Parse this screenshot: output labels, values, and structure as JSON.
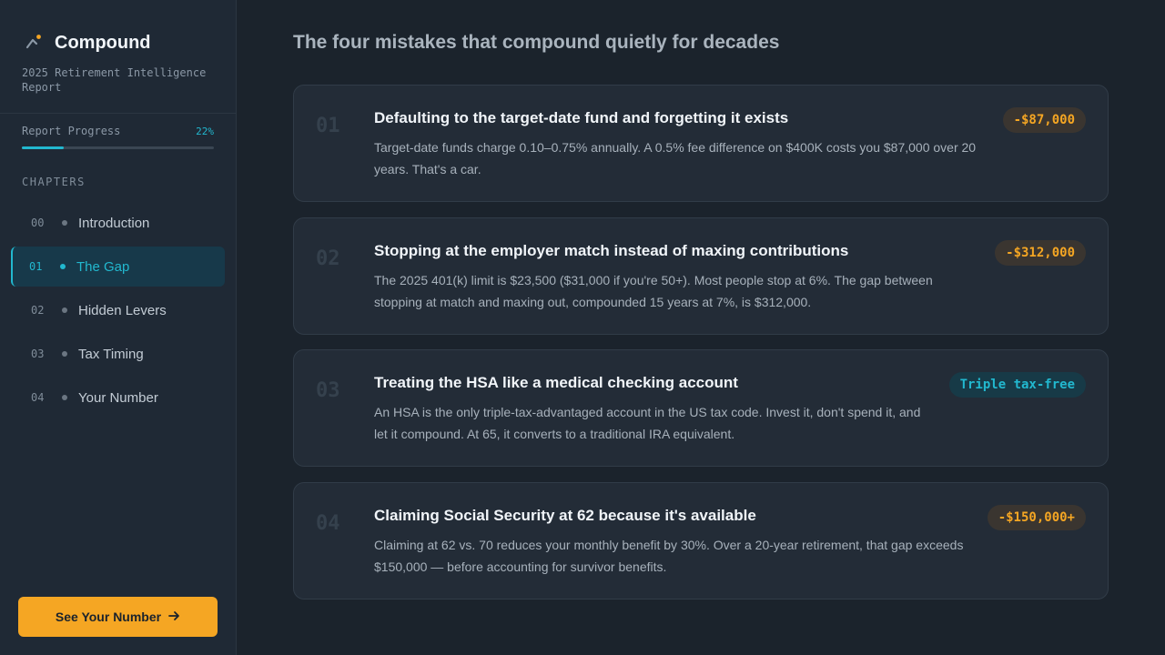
{
  "sidebar": {
    "brand": {
      "icon": "chart-up-icon",
      "title": "Compound",
      "subtitle": "2025 Retirement Intelligence Report"
    },
    "progress": {
      "label": "Report Progress",
      "value_text": "22%",
      "fraction": 0.22
    },
    "chapters_heading": "CHAPTERS",
    "chapters": [
      {
        "num": "00",
        "label": "Introduction",
        "active": false
      },
      {
        "num": "01",
        "label": "The Gap",
        "active": true
      },
      {
        "num": "02",
        "label": "Hidden Levers",
        "active": false
      },
      {
        "num": "03",
        "label": "Tax Timing",
        "active": false
      },
      {
        "num": "04",
        "label": "Your Number",
        "active": false
      }
    ],
    "cta": {
      "label": "See Your Number",
      "icon": "arrow-right-icon"
    }
  },
  "main": {
    "title": "The four mistakes that compound quietly for decades",
    "cards": [
      {
        "num": "01",
        "title": "Defaulting to the target-date fund and forgetting it exists",
        "body_lines": [
          "Target-date funds charge 0.10–0.75% annually. A 0.5% fee difference on $400K costs you $87,000 over 20",
          "years. That's a car."
        ],
        "badge": "-$87,000",
        "badge_kind": "loss"
      },
      {
        "num": "02",
        "title": "Stopping at the employer match instead of maxing contributions",
        "body_lines": [
          "The 2025 401(k) limit is $23,500 ($31,000 if you're 50+). Most people stop at 6%. The gap between",
          "stopping at match and maxing out, compounded 15 years at 7%, is $312,000."
        ],
        "badge": "-$312,000",
        "badge_kind": "loss"
      },
      {
        "num": "03",
        "title": "Treating the HSA like a medical checking account",
        "body_lines": [
          "An HSA is the only triple-tax-advantaged account in the US tax code. Invest it, don't spend it, and",
          "let it compound. At 65, it converts to a traditional IRA equivalent."
        ],
        "badge": "Triple tax-free",
        "badge_kind": "gain"
      },
      {
        "num": "04",
        "title": "Claiming Social Security at 62 because it's available",
        "body_lines": [
          "Claiming at 62 vs. 70 reduces your monthly benefit by 30%. Over a 20-year retirement, that gap exceeds",
          "$150,000 — before accounting for survivor benefits."
        ],
        "badge": "-$150,000+",
        "badge_kind": "loss"
      }
    ]
  },
  "colors": {
    "accent": "#22b8cf",
    "warning": "#f5a623",
    "background": "#1b232c",
    "sidebar": "#1f2935",
    "card": "#232c37"
  }
}
